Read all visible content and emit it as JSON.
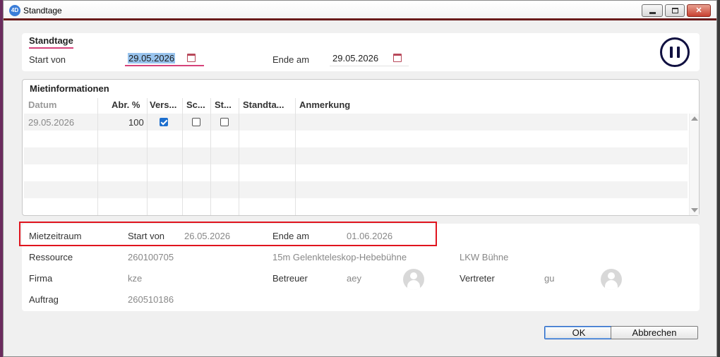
{
  "window": {
    "title": "Standtage",
    "app_icon": "4D",
    "controls": {
      "minimize": "minimize-icon",
      "maximize": "maximize-icon",
      "close": "✕"
    }
  },
  "standtage": {
    "title": "Standtage",
    "start_label": "Start von",
    "start_value": "29.05.2026",
    "end_label": "Ende am",
    "end_value": "29.05.2026",
    "pause_icon": "pause-circle-icon"
  },
  "mietinformationen": {
    "title": "Mietinformationen",
    "columns": [
      "Datum",
      "Abr. %",
      "Vers...",
      "Sc...",
      "St...",
      "Standta...",
      "Anmerkung"
    ],
    "rows": [
      {
        "datum": "29.05.2026",
        "abr": "100",
        "vers": true,
        "sc": false,
        "st": false,
        "standtage": "",
        "anmerkung": ""
      }
    ]
  },
  "info": {
    "mietzeitraum_label": "Mietzeitraum",
    "start_label": "Start von",
    "start_value": "26.05.2026",
    "end_label": "Ende am",
    "end_value": "01.06.2026",
    "ressource_label": "Ressource",
    "ressource_value": "260100705",
    "ressource_desc": "15m Gelenkteleskop-Hebebühne",
    "ressource_type": "LKW Bühne",
    "firma_label": "Firma",
    "firma_value": "kze",
    "betreuer_label": "Betreuer",
    "betreuer_value": "aey",
    "vertreter_label": "Vertreter",
    "vertreter_value": "gu",
    "auftrag_label": "Auftrag",
    "auftrag_value": "260510186"
  },
  "buttons": {
    "ok": "OK",
    "cancel": "Abbrechen"
  },
  "colors": {
    "accent_underline": "#d6427a",
    "highlight_box": "#e0141e",
    "titlebar_border": "#6a1b1b",
    "checkbox_checked": "#1d6fce"
  }
}
